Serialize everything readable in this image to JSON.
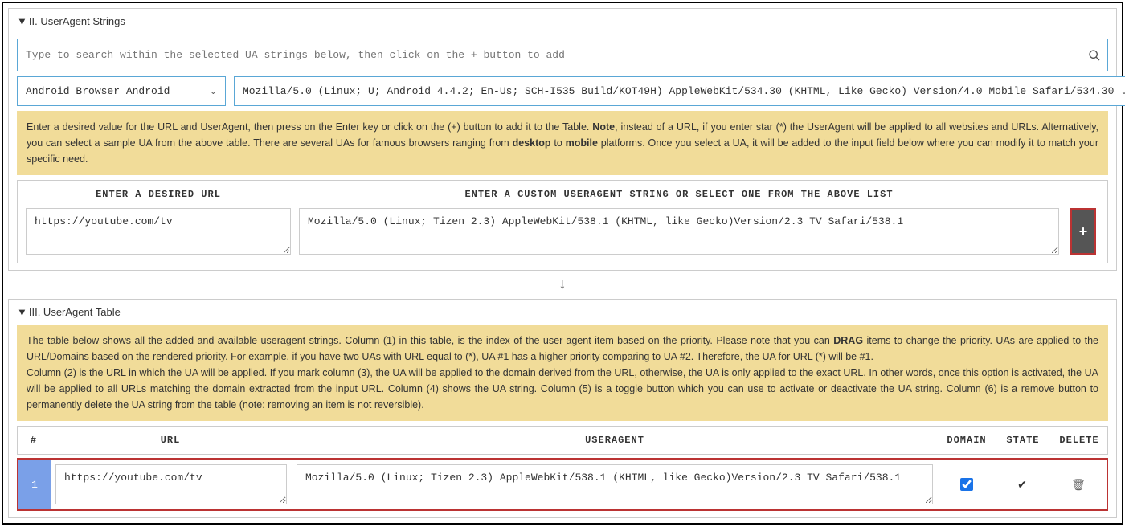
{
  "section2": {
    "title": "II. UserAgent Strings",
    "search_placeholder": "Type to search within the selected UA strings below, then click on the + button to add",
    "browser_select": "Android Browser Android",
    "ua_select": "Mozilla/5.0 (Linux; U; Android 4.4.2; En-Us; SCH-I535 Build/KOT49H) AppleWebKit/534.30 (KHTML, Like Gecko) Version/4.0 Mobile Safari/534.30",
    "notice_pre": "Enter a desired value for the URL and UserAgent, then press on the Enter key or click on the (+) button to add it to the Table. ",
    "notice_bold1": "Note",
    "notice_mid": ", instead of a URL, if you enter star (*) the UserAgent will be applied to all websites and URLs. Alternatively, you can select a sample UA from the above table. There are several UAs for famous browsers ranging from ",
    "notice_bold2": "desktop",
    "notice_mid2": " to ",
    "notice_bold3": "mobile",
    "notice_post": " platforms. Once you select a UA, it will be added to the input field below where you can modify it to match your specific need.",
    "url_header": "ENTER A DESIRED URL",
    "ua_header": "ENTER A CUSTOM USERAGENT STRING OR SELECT ONE FROM THE ABOVE LIST",
    "url_value": "https://youtube.com/tv",
    "ua_value": "Mozilla/5.0 (Linux; Tizen 2.3) AppleWebKit/538.1 (KHTML, like Gecko)Version/2.3 TV Safari/538.1",
    "add_label": "+"
  },
  "section3": {
    "title": "III. UserAgent Table",
    "notice_p1_pre": "The table below shows all the added and available useragent strings. Column (1) in this table, is the index of the user-agent item based on the priority. Please note that you can ",
    "notice_p1_bold": "DRAG",
    "notice_p1_post": " items to change the priority. UAs are applied to the URL/Domains based on the rendered priority. For example, if you have two UAs with URL equal to (*), UA #1 has a higher priority comparing to UA #2. Therefore, the UA for URL (*) will be #1.",
    "notice_p2": "Column (2) is the URL in which the UA will be applied. If you mark column (3), the UA will be applied to the domain derived from the URL, otherwise, the UA is only applied to the exact URL. In other words, once this option is activated, the UA will be applied to all URLs matching the domain extracted from the input URL. Column (4) shows the UA string. Column (5) is a toggle button which you can use to activate or deactivate the UA string. Column (6) is a remove button to permanently delete the UA string from the table (note: removing an item is not reversible).",
    "headers": {
      "index": "#",
      "url": "URL",
      "ua": "USERAGENT",
      "domain": "DOMAIN",
      "state": "STATE",
      "delete": "DELETE"
    },
    "row": {
      "index": "1",
      "url": "https://youtube.com/tv",
      "ua": "Mozilla/5.0 (Linux; Tizen 2.3) AppleWebKit/538.1 (KHTML, like Gecko)Version/2.3 TV Safari/538.1",
      "domain_checked": true,
      "state": "✔"
    }
  }
}
